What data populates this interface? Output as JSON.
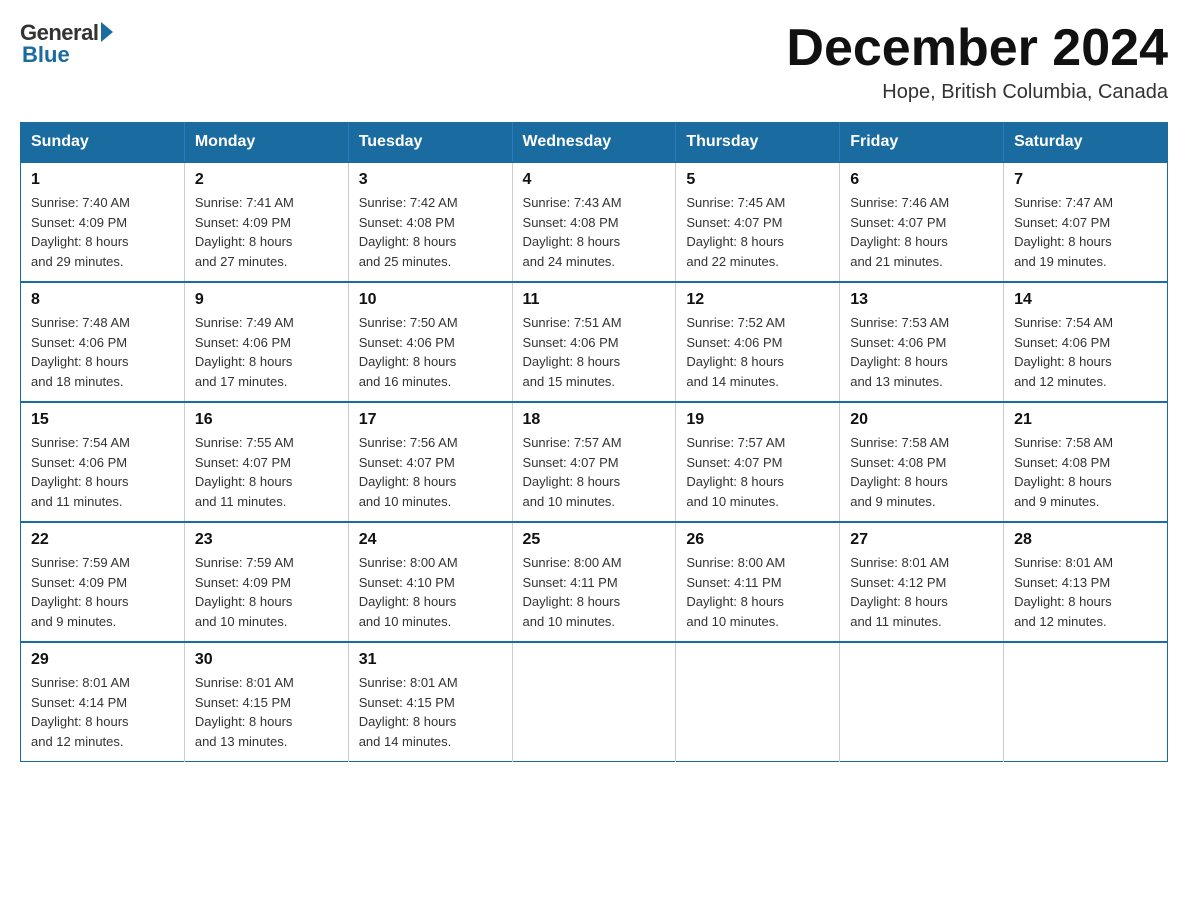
{
  "logo": {
    "general": "General",
    "blue": "Blue"
  },
  "title": "December 2024",
  "location": "Hope, British Columbia, Canada",
  "days_of_week": [
    "Sunday",
    "Monday",
    "Tuesday",
    "Wednesday",
    "Thursday",
    "Friday",
    "Saturday"
  ],
  "weeks": [
    [
      {
        "day": "1",
        "sunrise": "7:40 AM",
        "sunset": "4:09 PM",
        "daylight": "8 hours and 29 minutes."
      },
      {
        "day": "2",
        "sunrise": "7:41 AM",
        "sunset": "4:09 PM",
        "daylight": "8 hours and 27 minutes."
      },
      {
        "day": "3",
        "sunrise": "7:42 AM",
        "sunset": "4:08 PM",
        "daylight": "8 hours and 25 minutes."
      },
      {
        "day": "4",
        "sunrise": "7:43 AM",
        "sunset": "4:08 PM",
        "daylight": "8 hours and 24 minutes."
      },
      {
        "day": "5",
        "sunrise": "7:45 AM",
        "sunset": "4:07 PM",
        "daylight": "8 hours and 22 minutes."
      },
      {
        "day": "6",
        "sunrise": "7:46 AM",
        "sunset": "4:07 PM",
        "daylight": "8 hours and 21 minutes."
      },
      {
        "day": "7",
        "sunrise": "7:47 AM",
        "sunset": "4:07 PM",
        "daylight": "8 hours and 19 minutes."
      }
    ],
    [
      {
        "day": "8",
        "sunrise": "7:48 AM",
        "sunset": "4:06 PM",
        "daylight": "8 hours and 18 minutes."
      },
      {
        "day": "9",
        "sunrise": "7:49 AM",
        "sunset": "4:06 PM",
        "daylight": "8 hours and 17 minutes."
      },
      {
        "day": "10",
        "sunrise": "7:50 AM",
        "sunset": "4:06 PM",
        "daylight": "8 hours and 16 minutes."
      },
      {
        "day": "11",
        "sunrise": "7:51 AM",
        "sunset": "4:06 PM",
        "daylight": "8 hours and 15 minutes."
      },
      {
        "day": "12",
        "sunrise": "7:52 AM",
        "sunset": "4:06 PM",
        "daylight": "8 hours and 14 minutes."
      },
      {
        "day": "13",
        "sunrise": "7:53 AM",
        "sunset": "4:06 PM",
        "daylight": "8 hours and 13 minutes."
      },
      {
        "day": "14",
        "sunrise": "7:54 AM",
        "sunset": "4:06 PM",
        "daylight": "8 hours and 12 minutes."
      }
    ],
    [
      {
        "day": "15",
        "sunrise": "7:54 AM",
        "sunset": "4:06 PM",
        "daylight": "8 hours and 11 minutes."
      },
      {
        "day": "16",
        "sunrise": "7:55 AM",
        "sunset": "4:07 PM",
        "daylight": "8 hours and 11 minutes."
      },
      {
        "day": "17",
        "sunrise": "7:56 AM",
        "sunset": "4:07 PM",
        "daylight": "8 hours and 10 minutes."
      },
      {
        "day": "18",
        "sunrise": "7:57 AM",
        "sunset": "4:07 PM",
        "daylight": "8 hours and 10 minutes."
      },
      {
        "day": "19",
        "sunrise": "7:57 AM",
        "sunset": "4:07 PM",
        "daylight": "8 hours and 10 minutes."
      },
      {
        "day": "20",
        "sunrise": "7:58 AM",
        "sunset": "4:08 PM",
        "daylight": "8 hours and 9 minutes."
      },
      {
        "day": "21",
        "sunrise": "7:58 AM",
        "sunset": "4:08 PM",
        "daylight": "8 hours and 9 minutes."
      }
    ],
    [
      {
        "day": "22",
        "sunrise": "7:59 AM",
        "sunset": "4:09 PM",
        "daylight": "8 hours and 9 minutes."
      },
      {
        "day": "23",
        "sunrise": "7:59 AM",
        "sunset": "4:09 PM",
        "daylight": "8 hours and 10 minutes."
      },
      {
        "day": "24",
        "sunrise": "8:00 AM",
        "sunset": "4:10 PM",
        "daylight": "8 hours and 10 minutes."
      },
      {
        "day": "25",
        "sunrise": "8:00 AM",
        "sunset": "4:11 PM",
        "daylight": "8 hours and 10 minutes."
      },
      {
        "day": "26",
        "sunrise": "8:00 AM",
        "sunset": "4:11 PM",
        "daylight": "8 hours and 10 minutes."
      },
      {
        "day": "27",
        "sunrise": "8:01 AM",
        "sunset": "4:12 PM",
        "daylight": "8 hours and 11 minutes."
      },
      {
        "day": "28",
        "sunrise": "8:01 AM",
        "sunset": "4:13 PM",
        "daylight": "8 hours and 12 minutes."
      }
    ],
    [
      {
        "day": "29",
        "sunrise": "8:01 AM",
        "sunset": "4:14 PM",
        "daylight": "8 hours and 12 minutes."
      },
      {
        "day": "30",
        "sunrise": "8:01 AM",
        "sunset": "4:15 PM",
        "daylight": "8 hours and 13 minutes."
      },
      {
        "day": "31",
        "sunrise": "8:01 AM",
        "sunset": "4:15 PM",
        "daylight": "8 hours and 14 minutes."
      },
      null,
      null,
      null,
      null
    ]
  ],
  "labels": {
    "sunrise": "Sunrise:",
    "sunset": "Sunset:",
    "daylight": "Daylight:"
  }
}
